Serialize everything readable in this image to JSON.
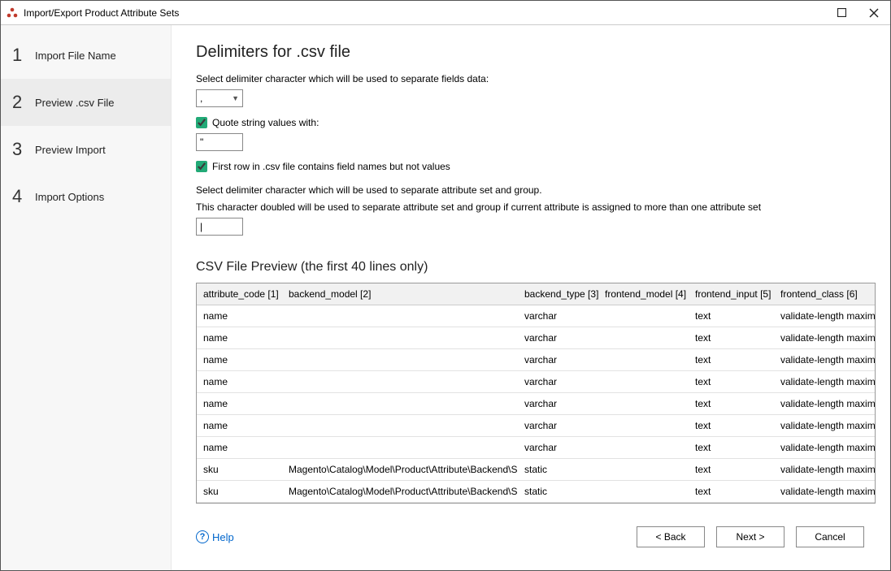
{
  "window": {
    "title": "Import/Export Product Attribute Sets"
  },
  "sidebar": {
    "steps": [
      {
        "num": "1",
        "label": "Import File Name"
      },
      {
        "num": "2",
        "label": "Preview .csv File"
      },
      {
        "num": "3",
        "label": "Preview Import"
      },
      {
        "num": "4",
        "label": "Import Options"
      }
    ],
    "active_index": 1
  },
  "main": {
    "heading": "Delimiters for .csv file",
    "delim_instr": "Select delimiter character which will be used to separate fields data:",
    "delim_value": ",",
    "quote_check_label": "Quote string values with:",
    "quote_checked": true,
    "quote_value": "\"",
    "firstrow_check_label": "First row in .csv file contains field names but not values",
    "firstrow_checked": true,
    "attrset_line1": "Select delimiter character which will be used to separate attribute set and group.",
    "attrset_line2": "This character doubled will be used to separate attribute set and group if current attribute is assigned to more than one attribute set",
    "attrset_value": "|",
    "preview_heading": "CSV File Preview (the first 40 lines only)",
    "columns": [
      "attribute_code [1]",
      "backend_model [2]",
      "backend_type [3]",
      "frontend_model [4]",
      "frontend_input [5]",
      "frontend_class [6]"
    ],
    "col_widths": [
      "105",
      "290",
      "99",
      "111",
      "105",
      "130"
    ],
    "rows": [
      [
        "name",
        "",
        "varchar",
        "",
        "text",
        "validate-length maximum"
      ],
      [
        "name",
        "",
        "varchar",
        "",
        "text",
        "validate-length maximum"
      ],
      [
        "name",
        "",
        "varchar",
        "",
        "text",
        "validate-length maximum"
      ],
      [
        "name",
        "",
        "varchar",
        "",
        "text",
        "validate-length maximum"
      ],
      [
        "name",
        "",
        "varchar",
        "",
        "text",
        "validate-length maximum"
      ],
      [
        "name",
        "",
        "varchar",
        "",
        "text",
        "validate-length maximum"
      ],
      [
        "name",
        "",
        "varchar",
        "",
        "text",
        "validate-length maximum"
      ],
      [
        "sku",
        "Magento\\Catalog\\Model\\Product\\Attribute\\Backend\\Sku",
        "static",
        "",
        "text",
        "validate-length maximum"
      ],
      [
        "sku",
        "Magento\\Catalog\\Model\\Product\\Attribute\\Backend\\Sku",
        "static",
        "",
        "text",
        "validate-length maximum"
      ]
    ]
  },
  "footer": {
    "help": "Help",
    "back": "< Back",
    "next": "Next >",
    "cancel": "Cancel"
  }
}
